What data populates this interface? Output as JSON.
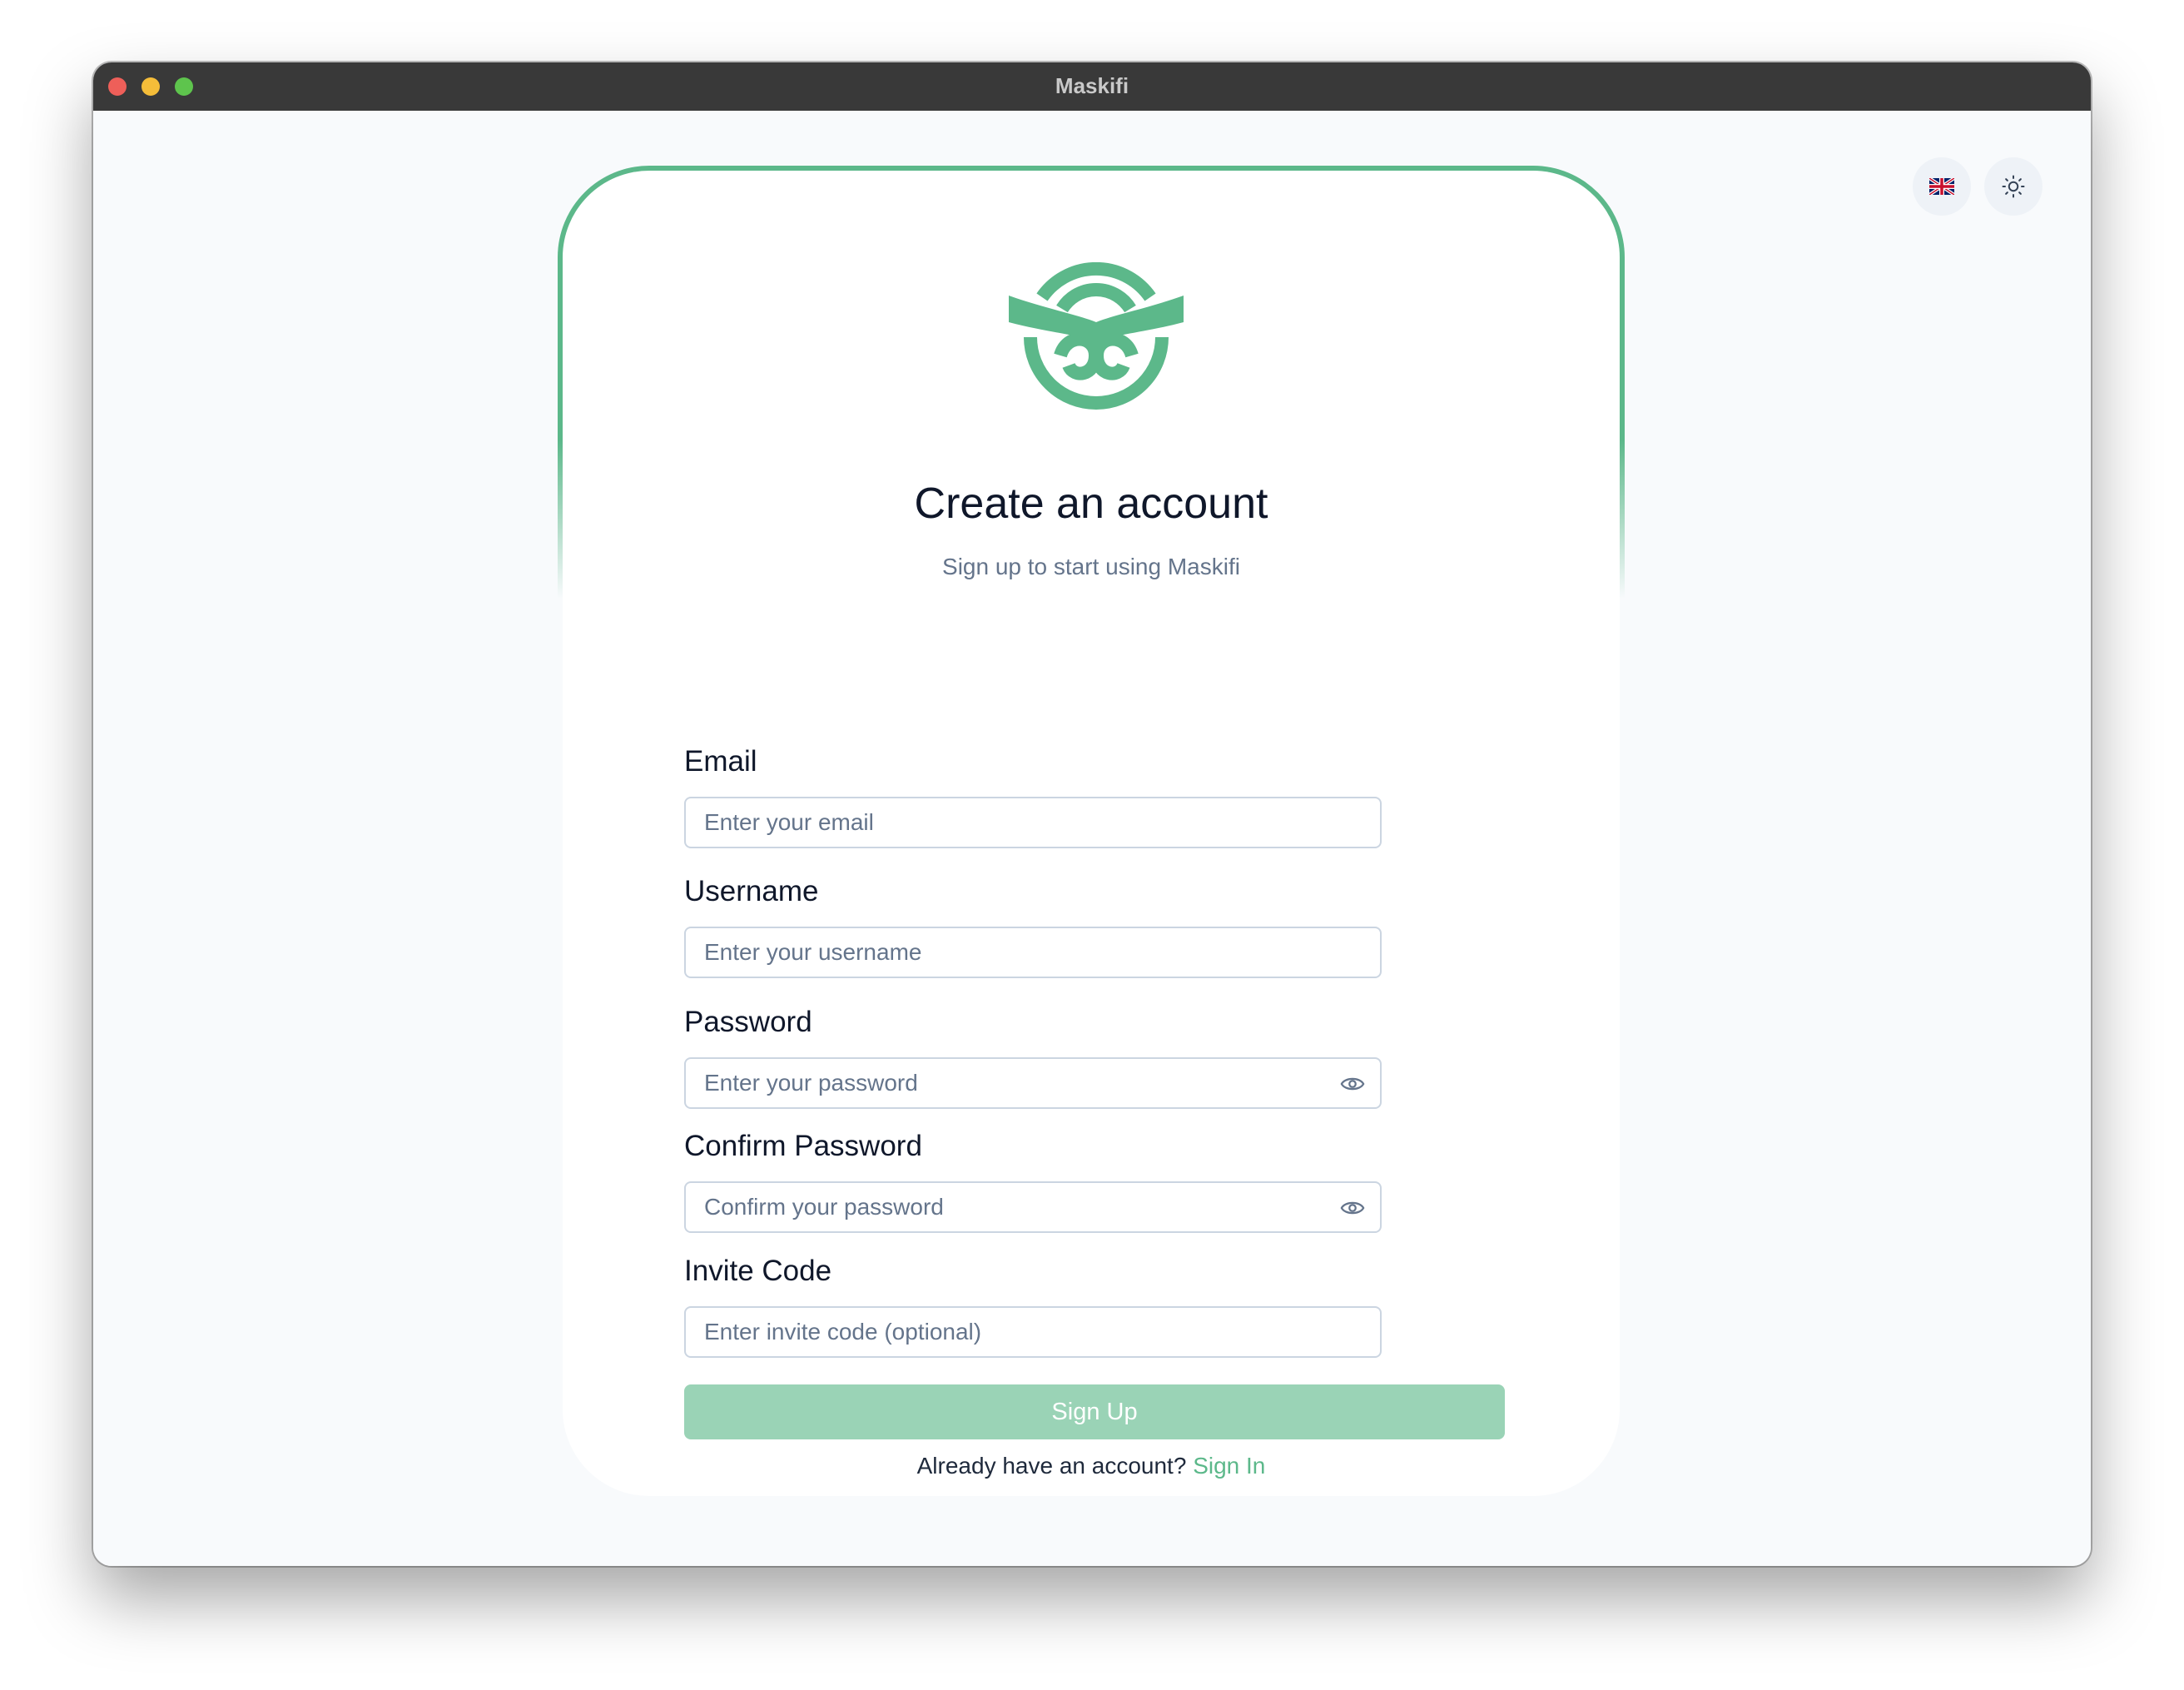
{
  "window": {
    "title": "Maskifi"
  },
  "topbar": {
    "language_icon": "uk-flag-icon",
    "theme_icon": "sun-icon"
  },
  "brand": {
    "logo_icon": "maskifi-logo-icon",
    "accent_color": "#5cb88a"
  },
  "form": {
    "title": "Create an account",
    "subtitle": "Sign up to start using Maskifi",
    "fields": [
      {
        "label": "Email",
        "placeholder": "Enter your email",
        "value": ""
      },
      {
        "label": "Username",
        "placeholder": "Enter your username",
        "value": ""
      },
      {
        "label": "Password",
        "placeholder": "Enter your password",
        "value": "",
        "icon": "eye-icon"
      },
      {
        "label": "Confirm Password",
        "placeholder": "Confirm your password",
        "value": "",
        "icon": "eye-icon"
      },
      {
        "label": "Invite Code",
        "placeholder": "Enter invite code (optional)",
        "value": ""
      }
    ],
    "submit_label": "Sign Up",
    "submit_color": "#9ad3b6",
    "footer_text": "Already have an account?",
    "footer_link": "Sign In"
  }
}
